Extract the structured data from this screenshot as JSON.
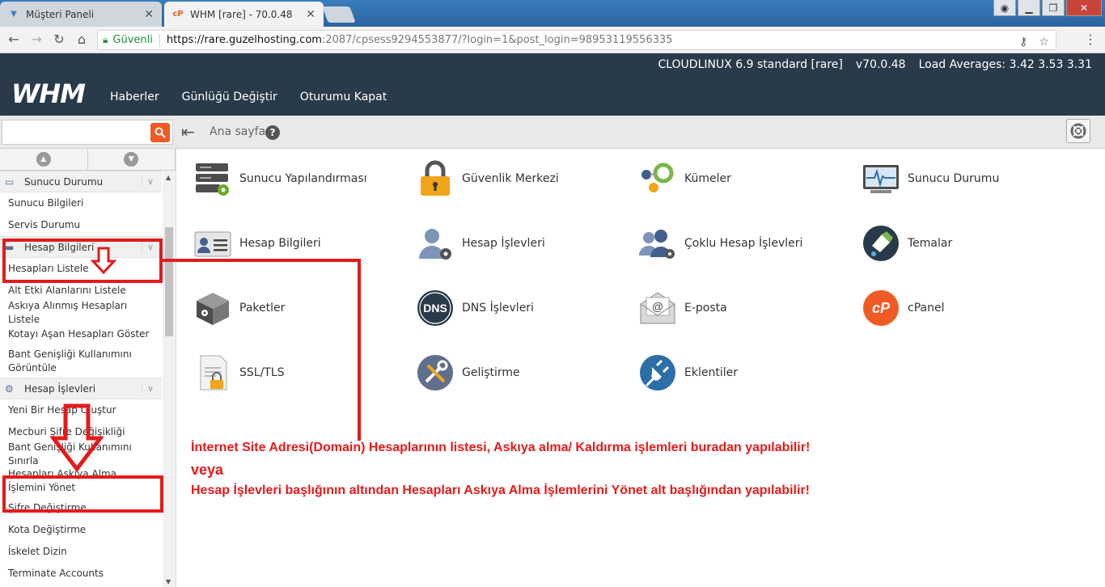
{
  "browser": {
    "tabs": [
      {
        "title": "Müşteri Paneli"
      },
      {
        "title": "WHM [rare] - 70.0.48"
      }
    ],
    "secure_label": "Güvenli",
    "url_host": "https://rare.guzelhosting.com",
    "url_path": ":2087/cpsess9294553877/?login=1&post_login=98953119556335"
  },
  "header": {
    "logo": "WHM",
    "os": "CLOUDLINUX 6.9 standard [rare]",
    "version": "v70.0.48",
    "load": "Load Averages: 3.42 3.53 3.31",
    "nav": [
      "Haberler",
      "Günlüğü Değiştir",
      "Oturumu Kapat"
    ]
  },
  "subbar": {
    "search_placeholder": "",
    "breadcrumb": "Ana sayfa"
  },
  "sidebar": {
    "groups": [
      {
        "label": "Sunucu Durumu",
        "items": [
          "Sunucu Bilgileri",
          "Servis Durumu"
        ]
      },
      {
        "label": "Hesap Bilgileri",
        "items": [
          "Hesapları Listele",
          "Alt Etki Alanlarını Listele",
          "Askıya Alınmış Hesapları Listele",
          "Kotayı Aşan Hesapları Göster",
          "Bant Genişliği Kullanımını Görüntüle"
        ]
      },
      {
        "label": "Hesap İşlevleri",
        "items": [
          "Yeni Bir Hesap Oluştur",
          "Mecburi Şifre Değişikliği",
          "Bant Genişliği Kullanımını Sınırla",
          "Hesapları Askıya Alma İşlemini Yönet",
          "Şifre Değiştirme",
          "Kota Değiştirme",
          "İskelet Dizin",
          "Terminate Accounts"
        ]
      }
    ]
  },
  "tiles": [
    {
      "label": "Sunucu Yapılandırması",
      "icon": "server-gear-icon"
    },
    {
      "label": "Güvenlik Merkezi",
      "icon": "padlock-icon"
    },
    {
      "label": "Kümeler",
      "icon": "cluster-icon"
    },
    {
      "label": "Sunucu Durumu",
      "icon": "monitor-pulse-icon"
    },
    {
      "label": "Hesap Bilgileri",
      "icon": "id-card-icon"
    },
    {
      "label": "Hesap İşlevleri",
      "icon": "user-gear-icon"
    },
    {
      "label": "Çoklu Hesap İşlevleri",
      "icon": "users-gear-icon"
    },
    {
      "label": "Temalar",
      "icon": "paint-bucket-icon"
    },
    {
      "label": "Paketler",
      "icon": "package-icon"
    },
    {
      "label": "DNS İşlevleri",
      "icon": "dns-icon"
    },
    {
      "label": "E-posta",
      "icon": "email-icon"
    },
    {
      "label": "cPanel",
      "icon": "cpanel-icon"
    },
    {
      "label": "SSL/TLS",
      "icon": "certificate-icon"
    },
    {
      "label": "Geliştirme",
      "icon": "tools-icon"
    },
    {
      "label": "Eklentiler",
      "icon": "plug-icon"
    }
  ],
  "annotation": {
    "line1": "İnternet Site Adresi(Domain) Hesaplarının listesi, Askıya alma/ Kaldırma işlemleri buradan yapılabilir!",
    "line2": "veya",
    "line3": "Hesap İşlevleri başlığının altından Hesapları Askıya Alma İşlemlerini Yönet alt başlığından yapılabilir!",
    "color": "#e31b1b"
  }
}
